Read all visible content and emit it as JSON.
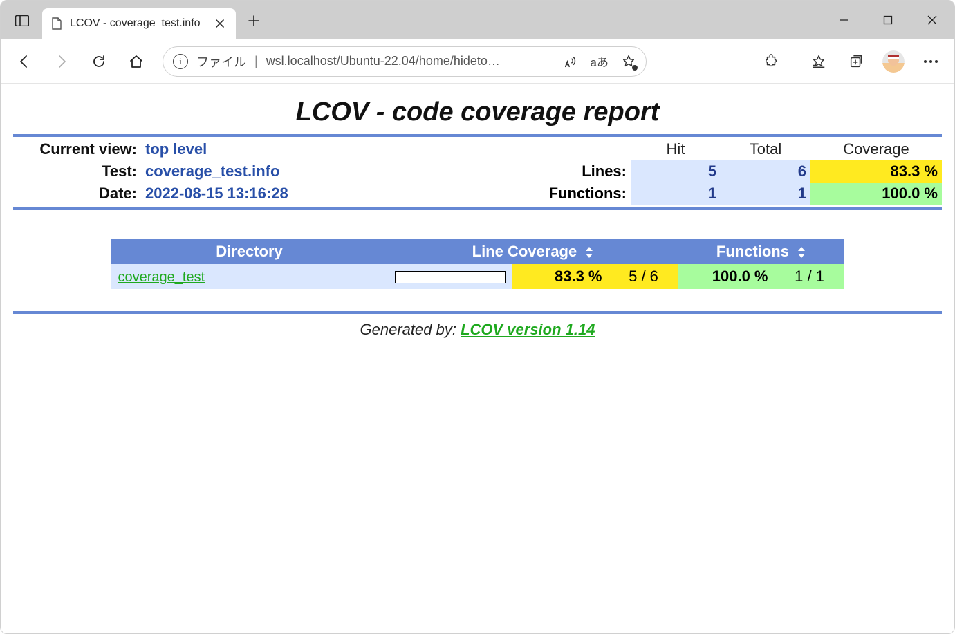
{
  "browser": {
    "tab_title": "LCOV - coverage_test.info",
    "file_word": "ファイル",
    "url": "wsl.localhost/Ubuntu-22.04/home/hideto…",
    "translate_label": "aあ"
  },
  "report": {
    "title": "LCOV - code coverage report",
    "labels": {
      "current_view": "Current view:",
      "test": "Test:",
      "date": "Date:",
      "lines": "Lines:",
      "functions": "Functions:",
      "hit": "Hit",
      "total": "Total",
      "coverage": "Coverage"
    },
    "current_view_value": "top level",
    "test_value": "coverage_test.info",
    "date_value": "2022-08-15 13:16:28",
    "summary": {
      "lines_hit": "5",
      "lines_total": "6",
      "lines_pct": "83.3 %",
      "funcs_hit": "1",
      "funcs_total": "1",
      "funcs_pct": "100.0 %"
    },
    "table": {
      "headers": {
        "directory": "Directory",
        "line_cov": "Line Coverage",
        "functions": "Functions"
      },
      "rows": [
        {
          "directory": "coverage_test",
          "line_pct": "83.3 %",
          "line_ratio": "5 / 6",
          "line_pct_num": 83.3,
          "func_pct": "100.0 %",
          "func_ratio": "1 / 1"
        }
      ]
    },
    "footer": {
      "prefix": "Generated by: ",
      "link_text": "LCOV version 1.14"
    }
  },
  "chart_data": {
    "type": "bar",
    "categories": [
      "coverage_test"
    ],
    "series": [
      {
        "name": "Line Coverage (%)",
        "values": [
          83.3
        ]
      },
      {
        "name": "Function Coverage (%)",
        "values": [
          100.0
        ]
      }
    ],
    "title": "LCOV - code coverage report",
    "xlabel": "Directory",
    "ylabel": "Coverage %",
    "ylim": [
      0,
      100
    ]
  }
}
